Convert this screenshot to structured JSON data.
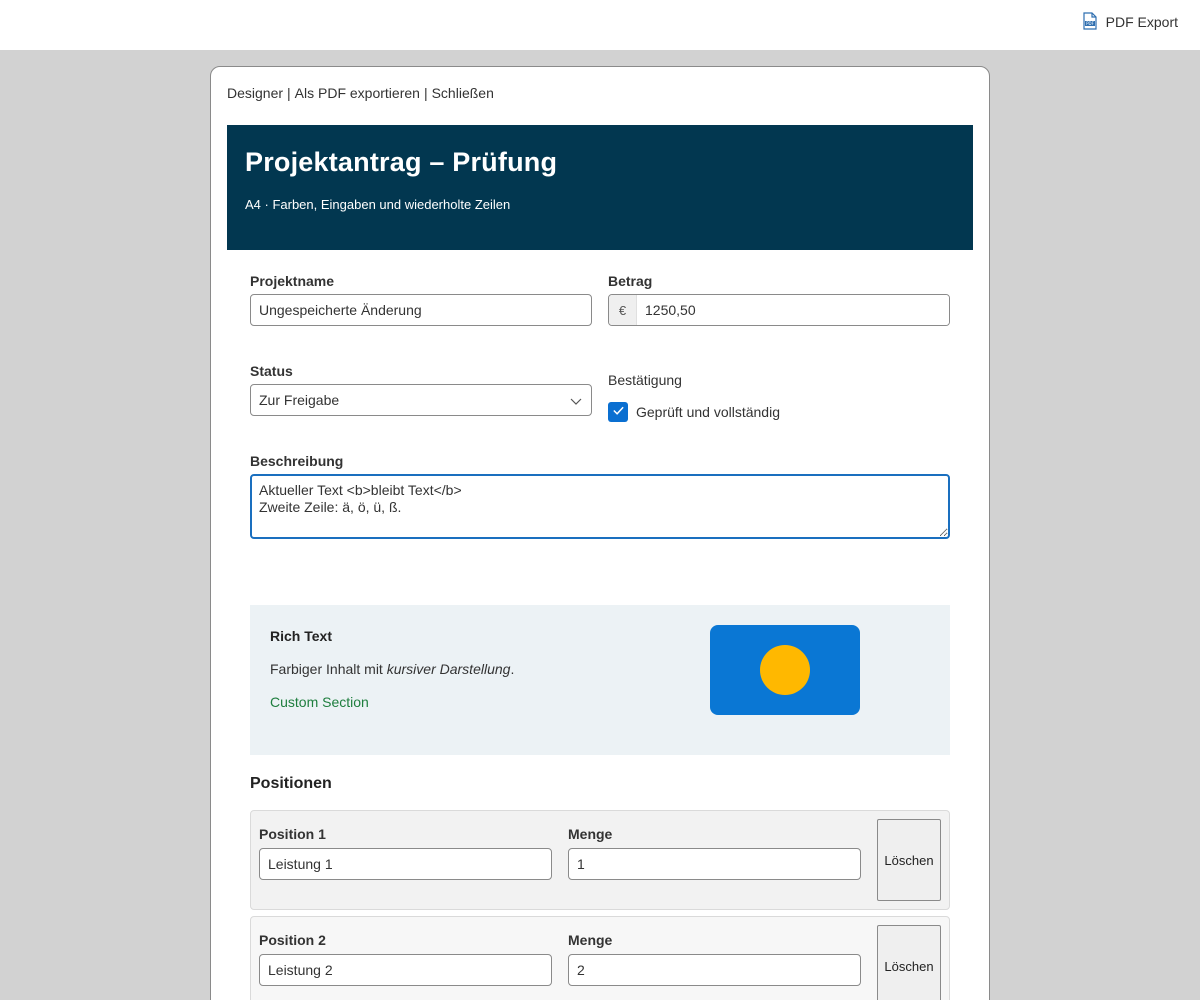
{
  "toolbar": {
    "pdf_export_label": "PDF Export",
    "pdf_icon": "pdf-file-icon"
  },
  "dialog": {
    "menu": {
      "designer": "Designer",
      "export_pdf": "Als PDF exportieren",
      "close": "Schließen",
      "separator": "|"
    },
    "header": {
      "title": "Projektantrag – Prüfung",
      "subtitle": "A4 · Farben, Eingaben und wiederholte Zeilen",
      "background_color": "#023750"
    },
    "form": {
      "project_name": {
        "label": "Projektname",
        "value": "Ungespeicherte Änderung"
      },
      "amount": {
        "label": "Betrag",
        "currency": "€",
        "value": "1250,50"
      },
      "status": {
        "label": "Status",
        "selected": "Zur Freigabe"
      },
      "confirmation": {
        "label": "Bestätigung",
        "checkbox_label": "Geprüft und vollständig",
        "checked": true
      },
      "description": {
        "label": "Beschreibung",
        "value": "Aktueller Text <b>bleibt Text</b>\nZweite Zeile: ä, ö, ü, ß."
      }
    },
    "rich_text": {
      "title": "Rich Text",
      "body_prefix": "Farbiger Inhalt mit ",
      "body_italic": "kursiver Darstellung",
      "body_suffix": ".",
      "link": "Custom Section",
      "background_color": "#ecf2f5",
      "image_color": "#0a77d4",
      "dot_color": "#ffb800",
      "link_color": "#1e7e3e"
    },
    "positions": {
      "heading": "Positionen",
      "quantity_label": "Menge",
      "delete_label": "Löschen",
      "rows": [
        {
          "label": "Position 1",
          "service": "Leistung 1",
          "quantity": "1"
        },
        {
          "label": "Position 2",
          "service": "Leistung 2",
          "quantity": "2"
        }
      ]
    }
  }
}
